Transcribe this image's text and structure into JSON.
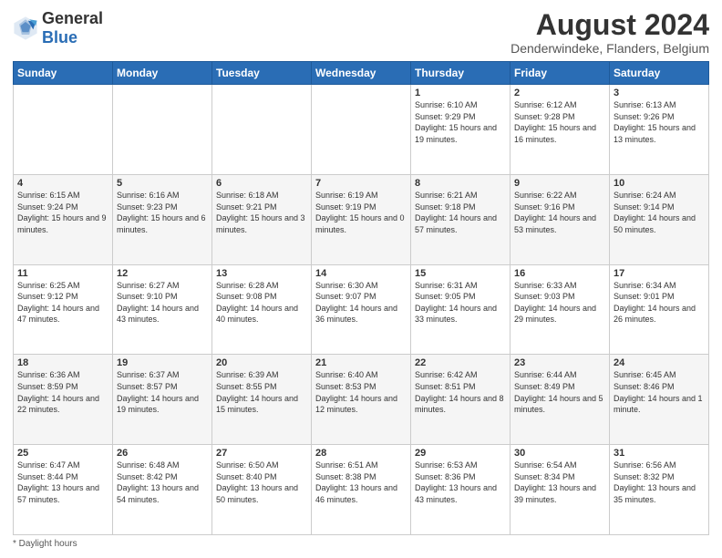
{
  "header": {
    "logo_general": "General",
    "logo_blue": "Blue",
    "title": "August 2024",
    "subtitle": "Denderwindeke, Flanders, Belgium"
  },
  "calendar": {
    "days_of_week": [
      "Sunday",
      "Monday",
      "Tuesday",
      "Wednesday",
      "Thursday",
      "Friday",
      "Saturday"
    ],
    "weeks": [
      [
        {
          "day": "",
          "info": ""
        },
        {
          "day": "",
          "info": ""
        },
        {
          "day": "",
          "info": ""
        },
        {
          "day": "",
          "info": ""
        },
        {
          "day": "1",
          "info": "Sunrise: 6:10 AM\nSunset: 9:29 PM\nDaylight: 15 hours\nand 19 minutes."
        },
        {
          "day": "2",
          "info": "Sunrise: 6:12 AM\nSunset: 9:28 PM\nDaylight: 15 hours\nand 16 minutes."
        },
        {
          "day": "3",
          "info": "Sunrise: 6:13 AM\nSunset: 9:26 PM\nDaylight: 15 hours\nand 13 minutes."
        }
      ],
      [
        {
          "day": "4",
          "info": "Sunrise: 6:15 AM\nSunset: 9:24 PM\nDaylight: 15 hours\nand 9 minutes."
        },
        {
          "day": "5",
          "info": "Sunrise: 6:16 AM\nSunset: 9:23 PM\nDaylight: 15 hours\nand 6 minutes."
        },
        {
          "day": "6",
          "info": "Sunrise: 6:18 AM\nSunset: 9:21 PM\nDaylight: 15 hours\nand 3 minutes."
        },
        {
          "day": "7",
          "info": "Sunrise: 6:19 AM\nSunset: 9:19 PM\nDaylight: 15 hours\nand 0 minutes."
        },
        {
          "day": "8",
          "info": "Sunrise: 6:21 AM\nSunset: 9:18 PM\nDaylight: 14 hours\nand 57 minutes."
        },
        {
          "day": "9",
          "info": "Sunrise: 6:22 AM\nSunset: 9:16 PM\nDaylight: 14 hours\nand 53 minutes."
        },
        {
          "day": "10",
          "info": "Sunrise: 6:24 AM\nSunset: 9:14 PM\nDaylight: 14 hours\nand 50 minutes."
        }
      ],
      [
        {
          "day": "11",
          "info": "Sunrise: 6:25 AM\nSunset: 9:12 PM\nDaylight: 14 hours\nand 47 minutes."
        },
        {
          "day": "12",
          "info": "Sunrise: 6:27 AM\nSunset: 9:10 PM\nDaylight: 14 hours\nand 43 minutes."
        },
        {
          "day": "13",
          "info": "Sunrise: 6:28 AM\nSunset: 9:08 PM\nDaylight: 14 hours\nand 40 minutes."
        },
        {
          "day": "14",
          "info": "Sunrise: 6:30 AM\nSunset: 9:07 PM\nDaylight: 14 hours\nand 36 minutes."
        },
        {
          "day": "15",
          "info": "Sunrise: 6:31 AM\nSunset: 9:05 PM\nDaylight: 14 hours\nand 33 minutes."
        },
        {
          "day": "16",
          "info": "Sunrise: 6:33 AM\nSunset: 9:03 PM\nDaylight: 14 hours\nand 29 minutes."
        },
        {
          "day": "17",
          "info": "Sunrise: 6:34 AM\nSunset: 9:01 PM\nDaylight: 14 hours\nand 26 minutes."
        }
      ],
      [
        {
          "day": "18",
          "info": "Sunrise: 6:36 AM\nSunset: 8:59 PM\nDaylight: 14 hours\nand 22 minutes."
        },
        {
          "day": "19",
          "info": "Sunrise: 6:37 AM\nSunset: 8:57 PM\nDaylight: 14 hours\nand 19 minutes."
        },
        {
          "day": "20",
          "info": "Sunrise: 6:39 AM\nSunset: 8:55 PM\nDaylight: 14 hours\nand 15 minutes."
        },
        {
          "day": "21",
          "info": "Sunrise: 6:40 AM\nSunset: 8:53 PM\nDaylight: 14 hours\nand 12 minutes."
        },
        {
          "day": "22",
          "info": "Sunrise: 6:42 AM\nSunset: 8:51 PM\nDaylight: 14 hours\nand 8 minutes."
        },
        {
          "day": "23",
          "info": "Sunrise: 6:44 AM\nSunset: 8:49 PM\nDaylight: 14 hours\nand 5 minutes."
        },
        {
          "day": "24",
          "info": "Sunrise: 6:45 AM\nSunset: 8:46 PM\nDaylight: 14 hours\nand 1 minute."
        }
      ],
      [
        {
          "day": "25",
          "info": "Sunrise: 6:47 AM\nSunset: 8:44 PM\nDaylight: 13 hours\nand 57 minutes."
        },
        {
          "day": "26",
          "info": "Sunrise: 6:48 AM\nSunset: 8:42 PM\nDaylight: 13 hours\nand 54 minutes."
        },
        {
          "day": "27",
          "info": "Sunrise: 6:50 AM\nSunset: 8:40 PM\nDaylight: 13 hours\nand 50 minutes."
        },
        {
          "day": "28",
          "info": "Sunrise: 6:51 AM\nSunset: 8:38 PM\nDaylight: 13 hours\nand 46 minutes."
        },
        {
          "day": "29",
          "info": "Sunrise: 6:53 AM\nSunset: 8:36 PM\nDaylight: 13 hours\nand 43 minutes."
        },
        {
          "day": "30",
          "info": "Sunrise: 6:54 AM\nSunset: 8:34 PM\nDaylight: 13 hours\nand 39 minutes."
        },
        {
          "day": "31",
          "info": "Sunrise: 6:56 AM\nSunset: 8:32 PM\nDaylight: 13 hours\nand 35 minutes."
        }
      ]
    ]
  },
  "footer": {
    "note": "Daylight hours"
  }
}
